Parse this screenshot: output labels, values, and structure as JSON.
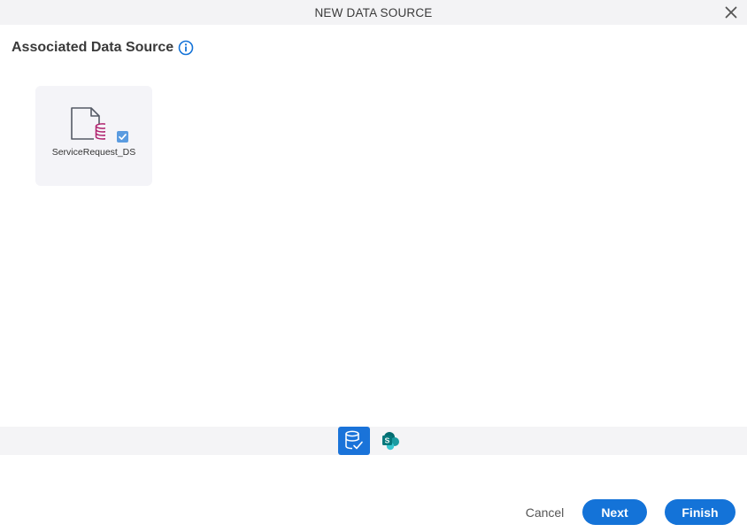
{
  "dialog": {
    "title": "NEW DATA SOURCE",
    "close_icon": "close-icon"
  },
  "section": {
    "heading": "Associated Data Source",
    "info_icon": "info-icon"
  },
  "data_sources": [
    {
      "label": "ServiceRequest_DS",
      "icon": "database-document-icon",
      "checked": true
    }
  ],
  "source_types": [
    {
      "icon": "database-check-icon",
      "active": true
    },
    {
      "icon": "sharepoint-icon",
      "active": false
    }
  ],
  "colors": {
    "primary": "#1473d8",
    "db_magenta": "#b0226e",
    "sharepoint_teal": "#038387"
  },
  "footer": {
    "cancel_label": "Cancel",
    "next_label": "Next",
    "finish_label": "Finish"
  }
}
